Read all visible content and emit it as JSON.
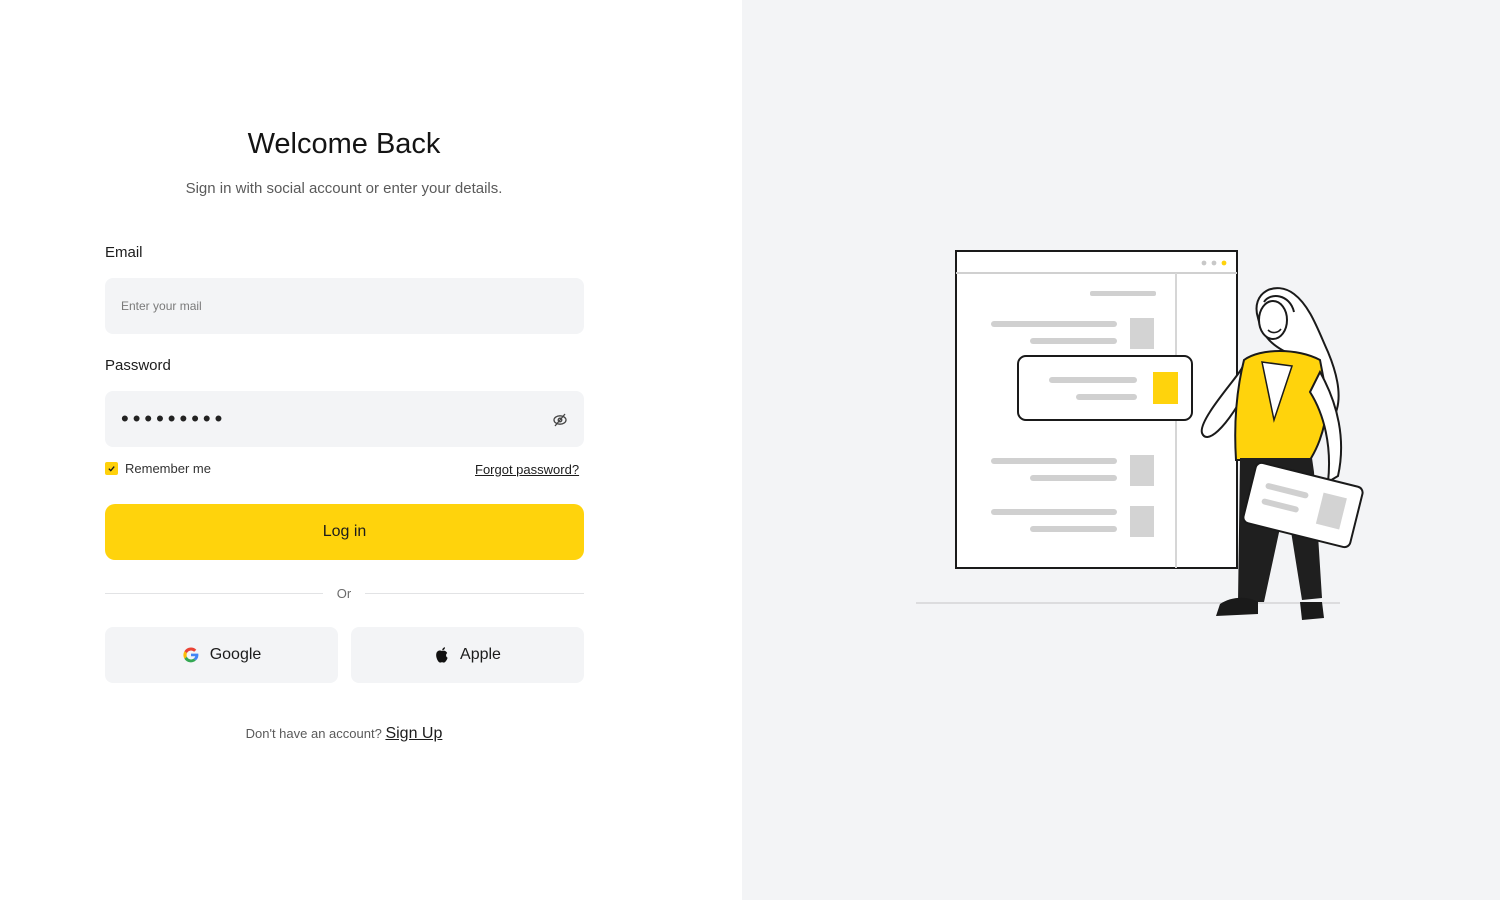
{
  "form": {
    "title": "Welcome Back",
    "subtitle": "Sign in with social account or enter your details.",
    "email_label": "Email",
    "email_placeholder": "Enter your mail",
    "email_value": "",
    "password_label": "Password",
    "password_value": "•••••••••",
    "remember_label": "Remember me",
    "remember_checked": true,
    "forgot_label": "Forgot password?",
    "login_label": "Log in",
    "divider_label": "Or",
    "google_label": "Google",
    "apple_label": "Apple",
    "signup_prompt": "Don't have an account?",
    "signup_label": "Sign Up"
  },
  "icons": {
    "password_toggle": "eye-off-icon",
    "remember": "check-icon",
    "google": "google-logo-icon",
    "apple": "apple-logo-icon"
  },
  "colors": {
    "accent": "#FFD30C",
    "panel_bg": "#F3F4F6",
    "text": "#1C1C1C"
  }
}
